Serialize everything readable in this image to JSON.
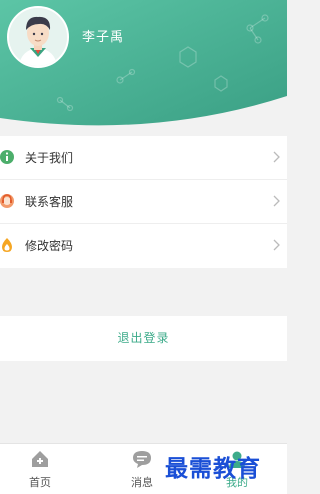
{
  "profile": {
    "username": "李子禹"
  },
  "menu": {
    "items": [
      {
        "label": "关于我们",
        "icon": "info-icon"
      },
      {
        "label": "联系客服",
        "icon": "customer-service-icon"
      },
      {
        "label": "修改密码",
        "icon": "password-flame-icon"
      }
    ]
  },
  "logout_label": "退出登录",
  "tabbar": {
    "tabs": [
      {
        "label": "首页",
        "icon": "home-icon",
        "active": false
      },
      {
        "label": "消息",
        "icon": "message-icon",
        "active": false
      },
      {
        "label": "我的",
        "icon": "profile-icon",
        "active": true
      }
    ]
  },
  "watermark": "最需教育",
  "colors": {
    "accent": "#3dab8a",
    "header_gradient_start": "#5cc5a6",
    "header_gradient_end": "#3a9f84",
    "background": "#f2f2f2"
  }
}
